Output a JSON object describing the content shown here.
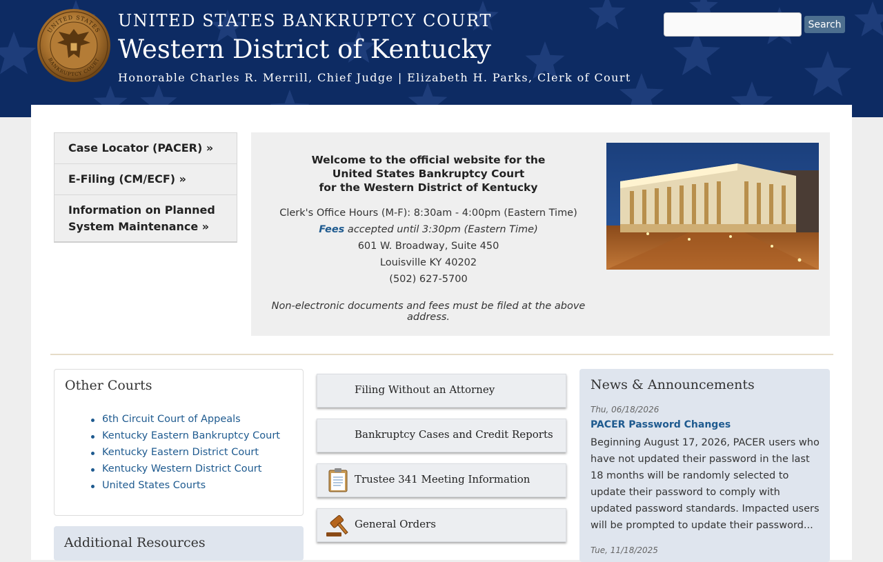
{
  "header": {
    "court_name": "UNITED STATES BANKRUPTCY COURT",
    "district": "Western District of Kentucky",
    "officials": "Honorable Charles R. Merrill, Chief Judge | Elizabeth H. Parks, Clerk of Court",
    "seal_ring_top": "UNITED STATES",
    "seal_ring_bottom": "BANKRUPTCY COURT"
  },
  "search": {
    "placeholder": "",
    "button_label": "Search"
  },
  "quick_links": [
    {
      "label": "Case Locator (PACER) »"
    },
    {
      "label": "E-Filing (CM/ECF) »"
    },
    {
      "label": "Information on Planned",
      "label_line2": "System Maintenance »"
    }
  ],
  "welcome": {
    "title_line1": "Welcome to the official website for the",
    "title_line2": "United States Bankruptcy Court",
    "title_line3": "for the Western District of Kentucky",
    "hours": "Clerk's Office Hours (M-F): 8:30am - 4:00pm (Eastern Time)",
    "fees_link": "Fees",
    "fees_note": " accepted until 3:30pm (Eastern Time)",
    "address1": "601 W. Broadway, Suite 450",
    "address2": "Louisville KY 40202",
    "phone": "(502) 627-5700",
    "notice": "Non-electronic documents and fees must be filed at the above address."
  },
  "other_courts": {
    "title": "Other Courts",
    "links": [
      "6th Circuit Court of Appeals",
      "Kentucky Eastern Bankruptcy Court",
      "Kentucky Eastern District Court",
      "Kentucky Western District Court",
      "United States Courts"
    ]
  },
  "additional_resources": {
    "title": "Additional Resources"
  },
  "tiles": [
    {
      "label": "Filing Without an Attorney",
      "icon": ""
    },
    {
      "label": "Bankruptcy Cases and Credit Reports",
      "icon": ""
    },
    {
      "label": "Trustee 341 Meeting Information",
      "icon": "clipboard-icon"
    },
    {
      "label": "General Orders",
      "icon": "gavel-icon"
    }
  ],
  "news": {
    "title": "News & Announcements",
    "items": [
      {
        "date": "Thu, 06/18/2026",
        "headline": "PACER Password Changes",
        "body": "Beginning August 17, 2026, PACER users who have not updated their password in the last 18 months will be randomly selected to update their password to comply with updated password standards. Impacted users will be prompted to update their password..."
      },
      {
        "date": "Tue, 11/18/2025"
      }
    ]
  },
  "colors": {
    "header_bg": "#0d2b63",
    "link": "#1e5a8f",
    "search_button": "#4d6f8f",
    "news_bg": "#dfe5ee"
  }
}
